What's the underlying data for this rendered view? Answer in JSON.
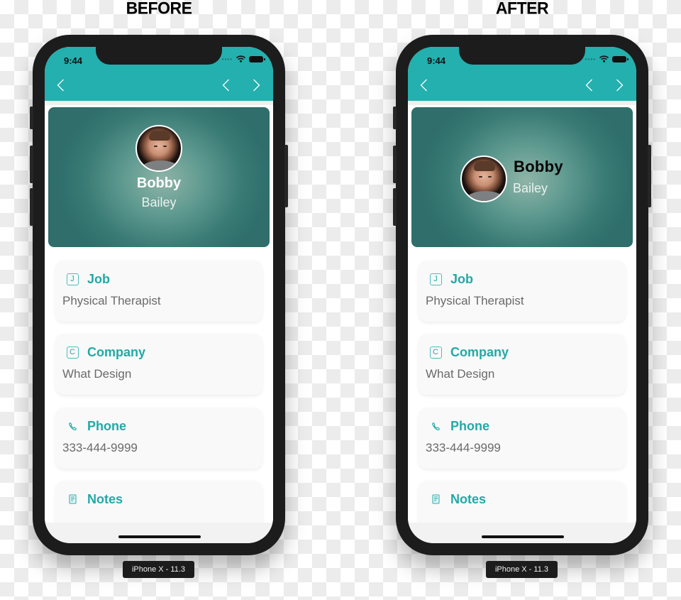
{
  "comparison": [
    {
      "id": "before",
      "heading": "BEFORE",
      "layout": "stacked",
      "device_label": "iPhone X - 11.3",
      "status_bar": {
        "time": "9:44"
      },
      "contact": {
        "first_name": "Bobby",
        "last_name": "Bailey"
      },
      "fields": [
        {
          "icon": "letter-j-icon",
          "icon_glyph": "J",
          "title": "Job",
          "value": "Physical Therapist"
        },
        {
          "icon": "letter-c-icon",
          "icon_glyph": "C",
          "title": "Company",
          "value": "What Design"
        },
        {
          "icon": "phone-icon",
          "icon_glyph": "",
          "title": "Phone",
          "value": "333-444-9999"
        },
        {
          "icon": "notes-icon",
          "icon_glyph": "",
          "title": "Notes",
          "value": ""
        }
      ]
    },
    {
      "id": "after",
      "heading": "AFTER",
      "layout": "inline",
      "device_label": "iPhone X - 11.3",
      "status_bar": {
        "time": "9:44"
      },
      "contact": {
        "first_name": "Bobby",
        "last_name": "Bailey"
      },
      "fields": [
        {
          "icon": "letter-j-icon",
          "icon_glyph": "J",
          "title": "Job",
          "value": "Physical Therapist"
        },
        {
          "icon": "letter-c-icon",
          "icon_glyph": "C",
          "title": "Company",
          "value": "What Design"
        },
        {
          "icon": "phone-icon",
          "icon_glyph": "",
          "title": "Phone",
          "value": "333-444-9999"
        },
        {
          "icon": "notes-icon",
          "icon_glyph": "",
          "title": "Notes",
          "value": ""
        }
      ]
    }
  ],
  "colors": {
    "accent": "#23b0ae",
    "accent_text": "#22a9a7",
    "value_text": "#6a6a6a",
    "device_frame": "#1c1c1c"
  }
}
